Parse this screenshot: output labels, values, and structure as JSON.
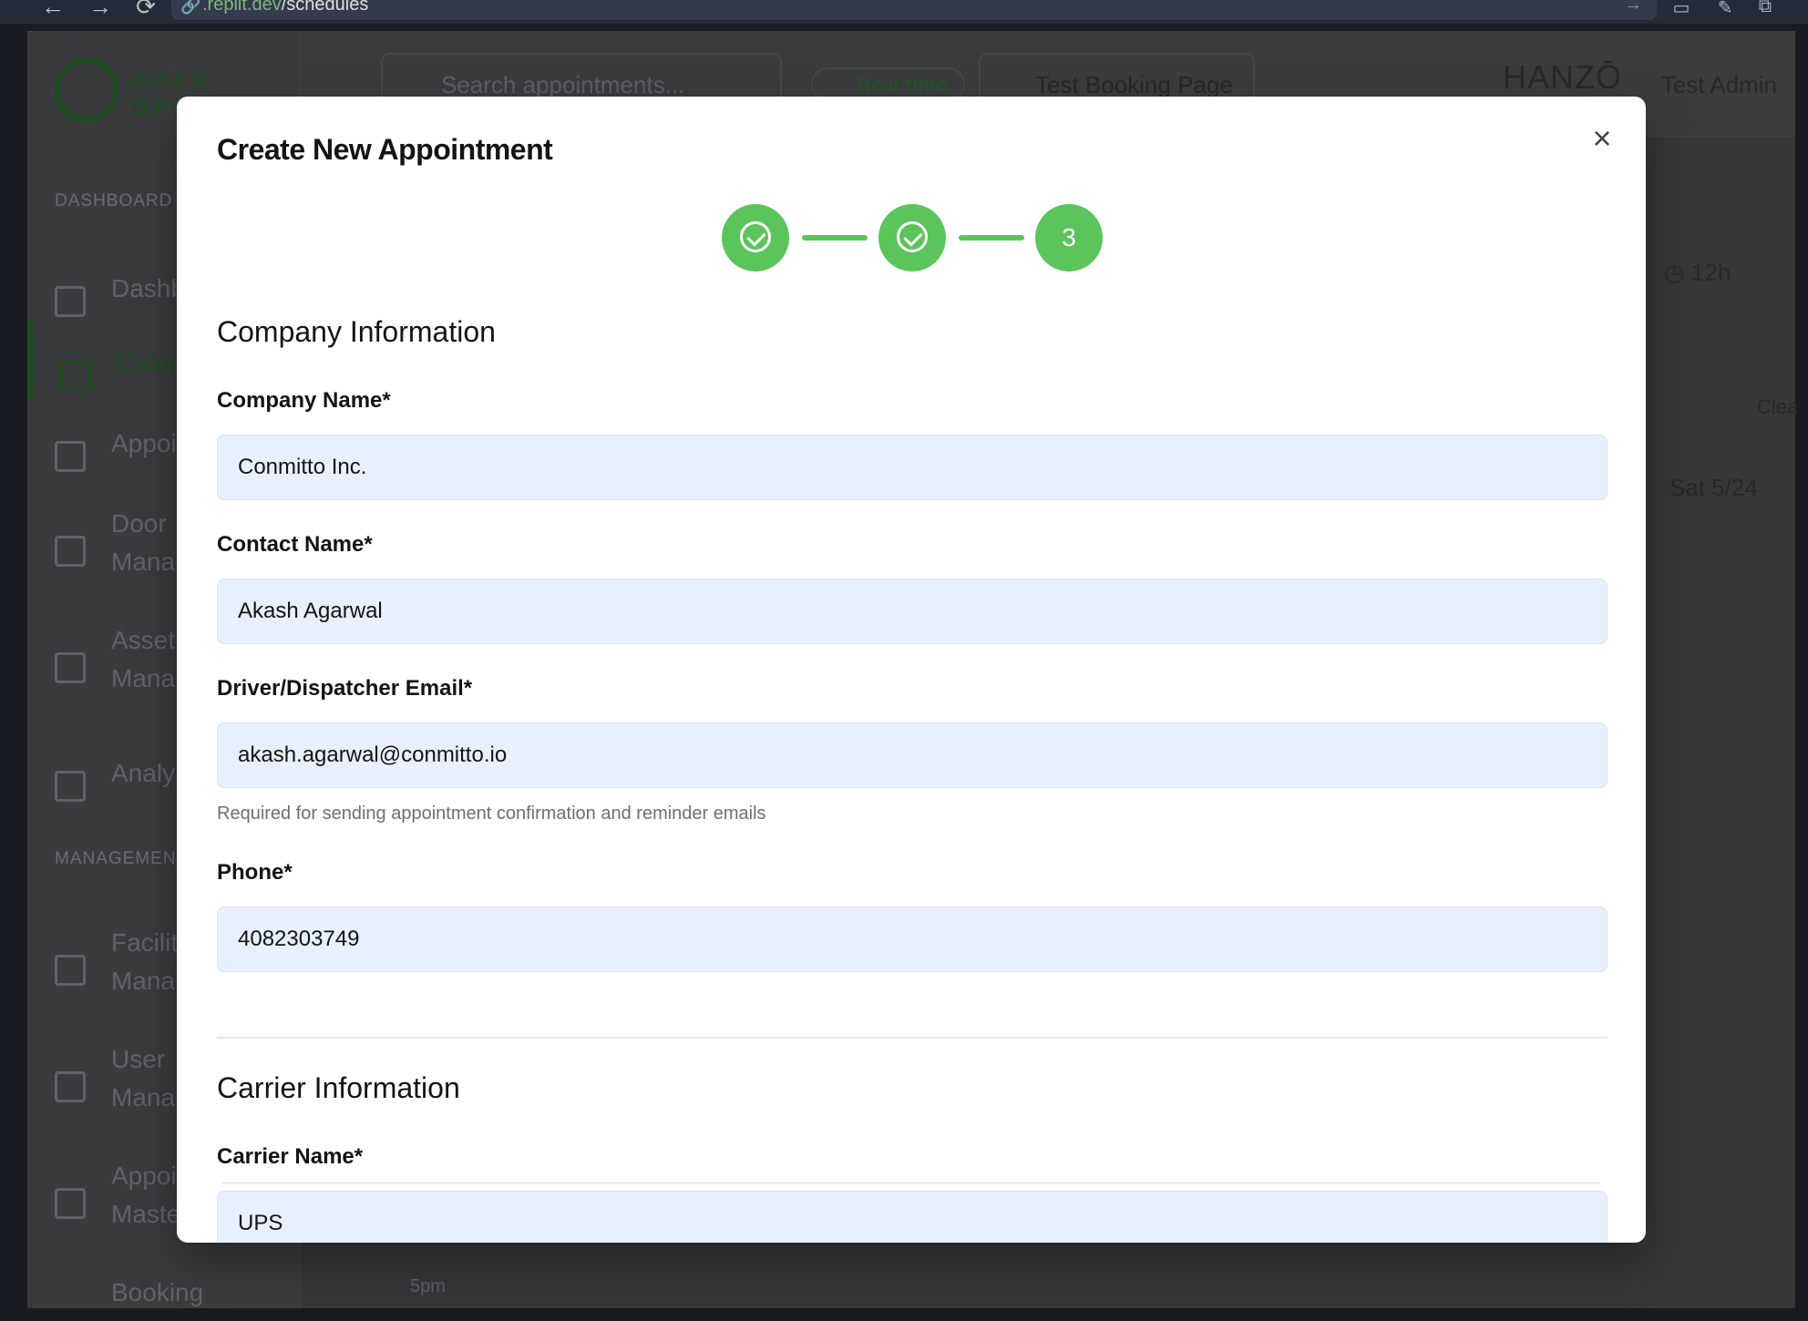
{
  "browser": {
    "url_prefix": ".replit.dev",
    "url_path": "/schedules"
  },
  "background_app": {
    "logo_text_line1": "DOCK",
    "logo_text_line2": "OPT",
    "sidebar": {
      "dashboard_section": "DASHBOARD",
      "management_section": "MANAGEMEN",
      "items": [
        {
          "label": "Dashb",
          "icon": "bar-chart-icon"
        },
        {
          "label": "Calen",
          "icon": "calendar-icon",
          "active": true
        },
        {
          "label": "Appoi",
          "icon": "calendar-clock-icon"
        },
        {
          "label": "Door Mana",
          "icon": "door-icon"
        },
        {
          "label": "Asset Mana",
          "icon": "box-icon"
        },
        {
          "label": "Analy",
          "icon": "bar-chart-icon"
        },
        {
          "label": "Facilit Mana",
          "icon": "building-icon"
        },
        {
          "label": "User Mana",
          "icon": "users-icon"
        },
        {
          "label": "Appoi Maste",
          "icon": "calendar-clock-icon"
        },
        {
          "label": "Booking",
          "icon": "globe-icon"
        }
      ]
    },
    "header": {
      "search_placeholder": "Search appointments...",
      "realtime_label": "Real-time",
      "test_booking_label": "Test Booking Page",
      "brand": "HANZŌ",
      "user_name": "Test Admin"
    },
    "toolbar_chip": "12h",
    "clear_chip": "Clea",
    "date_chip": "Sat 5/24",
    "time_label": "5pm"
  },
  "modal": {
    "title": "Create New Appointment",
    "steps": [
      {
        "state": "complete",
        "label": ""
      },
      {
        "state": "complete",
        "label": ""
      },
      {
        "state": "current",
        "label": "3"
      }
    ],
    "company_section_title": "Company Information",
    "fields": {
      "company_name": {
        "label": "Company Name*",
        "value": "Conmitto Inc."
      },
      "contact_name": {
        "label": "Contact Name*",
        "value": "Akash Agarwal"
      },
      "email": {
        "label": "Driver/Dispatcher Email*",
        "value": "akash.agarwal@conmitto.io",
        "helper": "Required for sending appointment confirmation and reminder emails"
      },
      "phone": {
        "label": "Phone*",
        "value": "4082303749"
      },
      "carrier_name": {
        "label": "Carrier Name*",
        "value": "UPS"
      }
    },
    "carrier_section_title": "Carrier Information"
  },
  "colors": {
    "accent_green": "#5bc55b",
    "input_bg": "#e8effd"
  }
}
